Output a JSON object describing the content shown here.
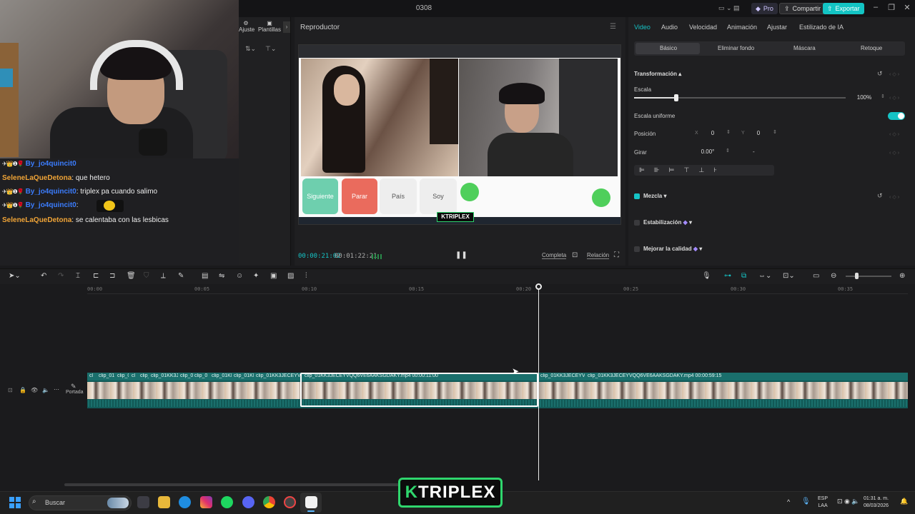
{
  "window": {
    "title": "0308",
    "pro_label": "Pro",
    "share_label": "Compartir",
    "export_label": "Exportar"
  },
  "left_panel": {
    "tools": [
      "Ajuste",
      "Plantillas"
    ]
  },
  "chat": {
    "lines": [
      {
        "user": "By_jo4quincit0",
        "message": "",
        "badges": "✈👑❶🌹",
        "color": "blue"
      },
      {
        "user": "SeleneLaQueDetona",
        "message": ": que hetero",
        "badges": "",
        "color": "orange"
      },
      {
        "user": "By_jo4quincit0",
        "message": ": triplex pa cuando salimo",
        "badges": "✈👑❶🌹",
        "color": "blue"
      },
      {
        "user": "By_jo4quincit0",
        "message": ":",
        "badges": "✈👑❶🌹",
        "color": "blue"
      },
      {
        "user": "SeleneLaQueDetona",
        "message": ": se calentaba con las lesbicas",
        "badges": "",
        "color": "orange"
      }
    ]
  },
  "player": {
    "title": "Reproductor",
    "buttons": {
      "next": "Siguiente",
      "stop": "Parar",
      "country": "País",
      "me": "Soy"
    },
    "watermark_small": "KTRIPLEX",
    "time_current": "00:00:21:02",
    "time_total": "00:01:22:21",
    "full_label": "Completa",
    "ratio_label": "Relación"
  },
  "props": {
    "tabs": [
      "Video",
      "Audio",
      "Velocidad",
      "Animación",
      "Ajustar",
      "Estilizado de IA"
    ],
    "subtabs": [
      "Básico",
      "Eliminar fondo",
      "Máscara",
      "Retoque"
    ],
    "transform_title": "Transformación",
    "scale_label": "Escala",
    "scale_value": "100%",
    "scale_fraction": 0.2,
    "uniform_label": "Escala uniforme",
    "uniform_on": true,
    "position_label": "Posición",
    "pos_x_label": "X",
    "pos_x": "0",
    "pos_y_label": "Y",
    "pos_y": "0",
    "rotate_label": "Girar",
    "rotate_value": "0.00°",
    "rotate_dash": "-",
    "blend_label": "Mezcla",
    "stabilize_label": "Estabilización",
    "enhance_label": "Mejorar la calidad"
  },
  "timeline": {
    "ticks": [
      "00:00",
      "00:05",
      "00:10",
      "00:15",
      "00:20",
      "00:25",
      "00:30",
      "00:35"
    ],
    "cover_label": "Portada",
    "clips": [
      "clip_01",
      "clip_0",
      "clip_0",
      "cl",
      "clip_01KK3J",
      "clip_0",
      "clip_0",
      "clip_01KK",
      "clip_01KK",
      "clip_01KK3JECEYVQ",
      "clip_01KK3JECEYVQQ6VE6AAKSGDAKY.mp4   00:00:11:00",
      "clip_01KK3JECEYVQ",
      "clip_01KK3JECEYVQQ6VE6AAKSGDAKY.mp4   00:00:59:15"
    ]
  },
  "watermark_big": {
    "k": "K",
    "rest": "TRIPLEX"
  },
  "taskbar": {
    "search_placeholder": "Buscar",
    "lang_1": "ESP",
    "lang_2": "LAA",
    "time": "01:31 a. m.",
    "date": "08/03/2026"
  },
  "colors": {
    "accent": "#15c3c5",
    "export": "#13c4c4",
    "watermark_green": "#2fd66d"
  }
}
